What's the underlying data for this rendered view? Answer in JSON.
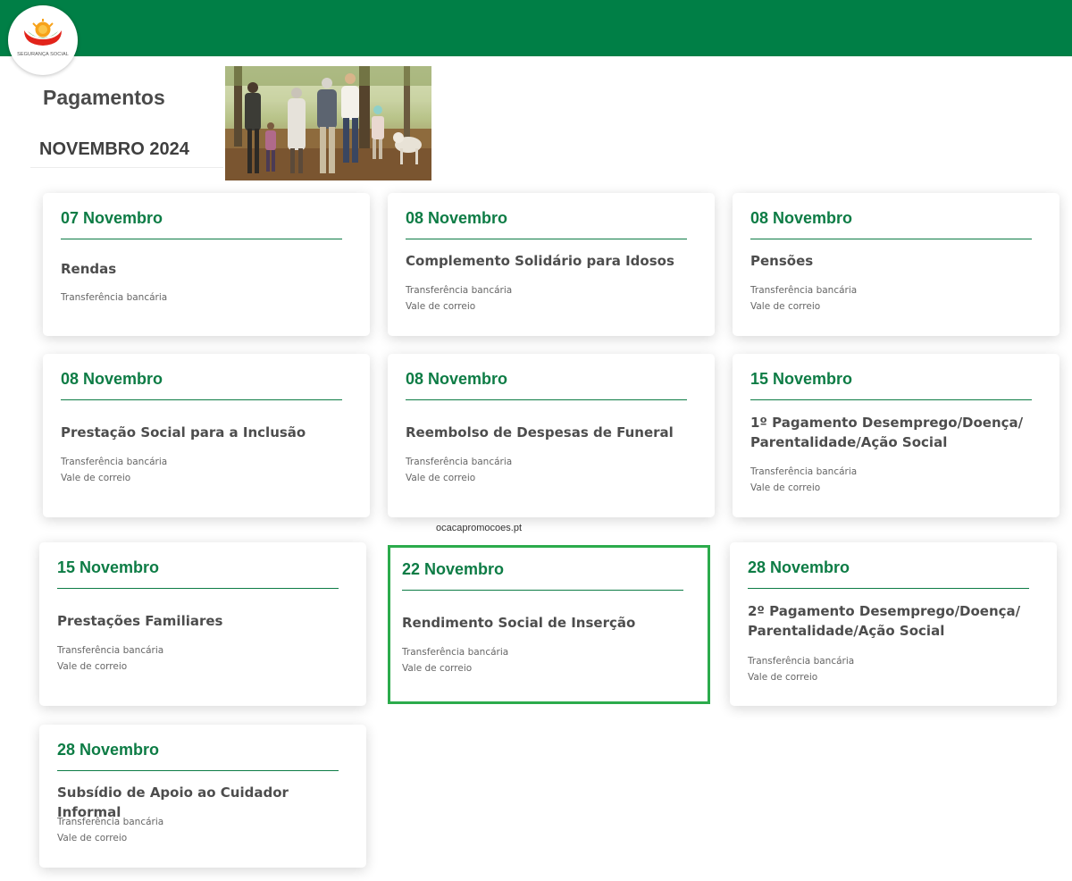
{
  "header": {
    "logo_text": "SEGURANÇA SOCIAL",
    "bar_color": "#007f46"
  },
  "page": {
    "title": "Pagamentos",
    "month": "NOVEMBRO 2024",
    "hero_image": "family-walking-park-photo"
  },
  "watermark": "ocacapromocoes.pt",
  "cards": [
    {
      "date": "07 Novembro",
      "title": "Rendas",
      "methods": [
        "Transferência bancária"
      ]
    },
    {
      "date": "08 Novembro",
      "title": "Complemento Solidário para Idosos",
      "methods": [
        "Transferência bancária",
        "Vale de correio"
      ]
    },
    {
      "date": "08 Novembro",
      "title": "Pensões",
      "methods": [
        "Transferência bancária",
        "Vale de correio"
      ]
    },
    {
      "date": "08 Novembro",
      "title": "Prestação Social para a Inclusão",
      "methods": [
        "Transferência bancária",
        "Vale de correio"
      ]
    },
    {
      "date": "08 Novembro",
      "title": "Reembolso de Despesas de Funeral",
      "methods": [
        "Transferência bancária",
        "Vale de correio"
      ]
    },
    {
      "date": "15 Novembro",
      "title": "1º Pagamento Desemprego/Doença/ Parentalidade/Ação Social",
      "methods": [
        "Transferência bancária",
        "Vale de correio"
      ]
    },
    {
      "date": "15 Novembro",
      "title": "Prestações Familiares",
      "methods": [
        "Transferência bancária",
        "Vale de correio"
      ]
    },
    {
      "date": "22 Novembro",
      "title": "Rendimento Social de Inserção",
      "methods": [
        "Transferência bancária",
        "Vale de correio"
      ]
    },
    {
      "date": "28 Novembro",
      "title": "2º Pagamento Desemprego/Doença/ Parentalidade/Ação Social",
      "methods": [
        "Transferência bancária",
        "Vale de correio"
      ]
    },
    {
      "date": "28 Novembro",
      "title": "Subsídio de Apoio ao Cuidador Informal",
      "methods": [
        "Transferência bancária",
        "Vale de correio"
      ]
    }
  ],
  "colors": {
    "accent": "#0d7c45",
    "highlight_border": "#2cab4c"
  }
}
